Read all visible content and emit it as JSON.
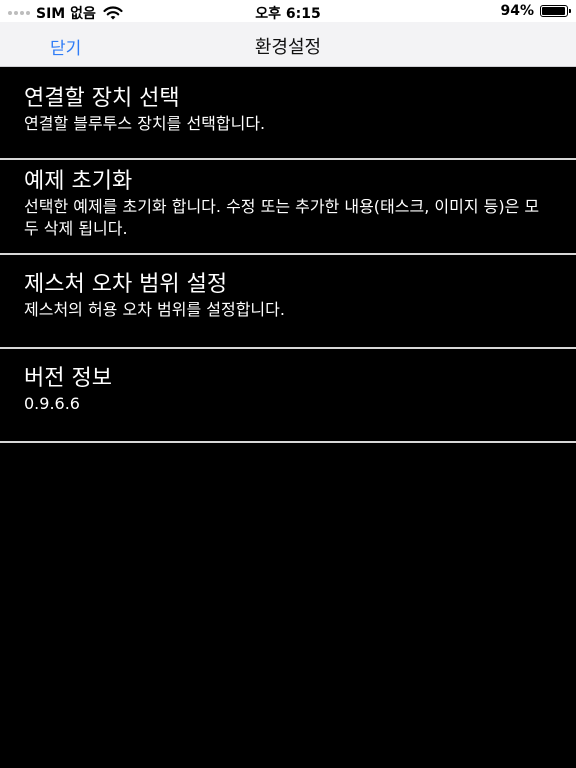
{
  "status_bar": {
    "carrier": "SIM 없음",
    "time": "오후 6:15",
    "battery_percent": "94%",
    "battery_level": 0.94
  },
  "nav": {
    "close_label": "닫기",
    "title": "환경설정",
    "accent_color": "#2f7cf6"
  },
  "settings": [
    {
      "title": "연결할 장치 선택",
      "description": "연결할 블루투스 장치를 선택합니다."
    },
    {
      "title": "예제 초기화",
      "description": "선택한 예제를 초기화 합니다. 수정 또는 추가한 내용(태스크, 이미지 등)은 모두 삭제 됩니다."
    },
    {
      "title": "제스처 오차 범위 설정",
      "description": "제스처의 허용 오차 범위를 설정합니다."
    },
    {
      "title": "버전 정보",
      "description": "0.9.6.6"
    }
  ]
}
